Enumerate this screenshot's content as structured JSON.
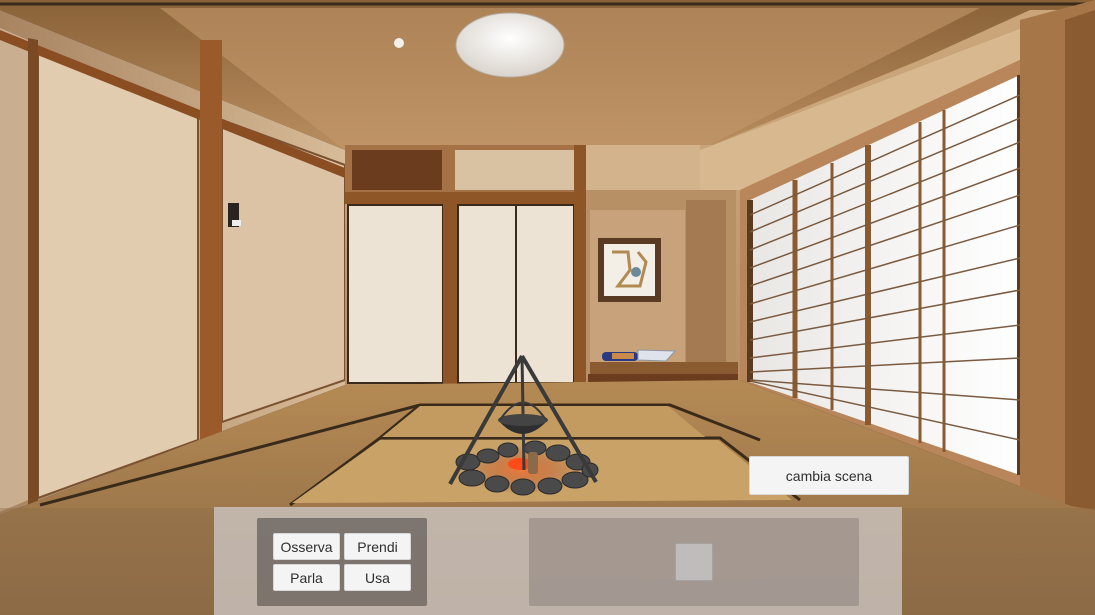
{
  "game": {
    "scene": "japanese-room",
    "change_scene_label": "cambia scena"
  },
  "actions": [
    {
      "key": "observe",
      "label": "Osserva"
    },
    {
      "key": "take",
      "label": "Prendi"
    },
    {
      "key": "talk",
      "label": "Parla"
    },
    {
      "key": "use",
      "label": "Usa"
    }
  ],
  "inventory": {
    "slots": 1
  },
  "scene_objects": {
    "items": [
      "knife",
      "campfire-with-pot"
    ],
    "icons": [
      "ceiling-lamp-icon",
      "framed-painting-icon",
      "wall-switch-icon"
    ]
  },
  "colors": {
    "button_bg": "#f4f4f4",
    "panel_bg": "#cdc7c4",
    "actions_bg": "#6e6662"
  }
}
